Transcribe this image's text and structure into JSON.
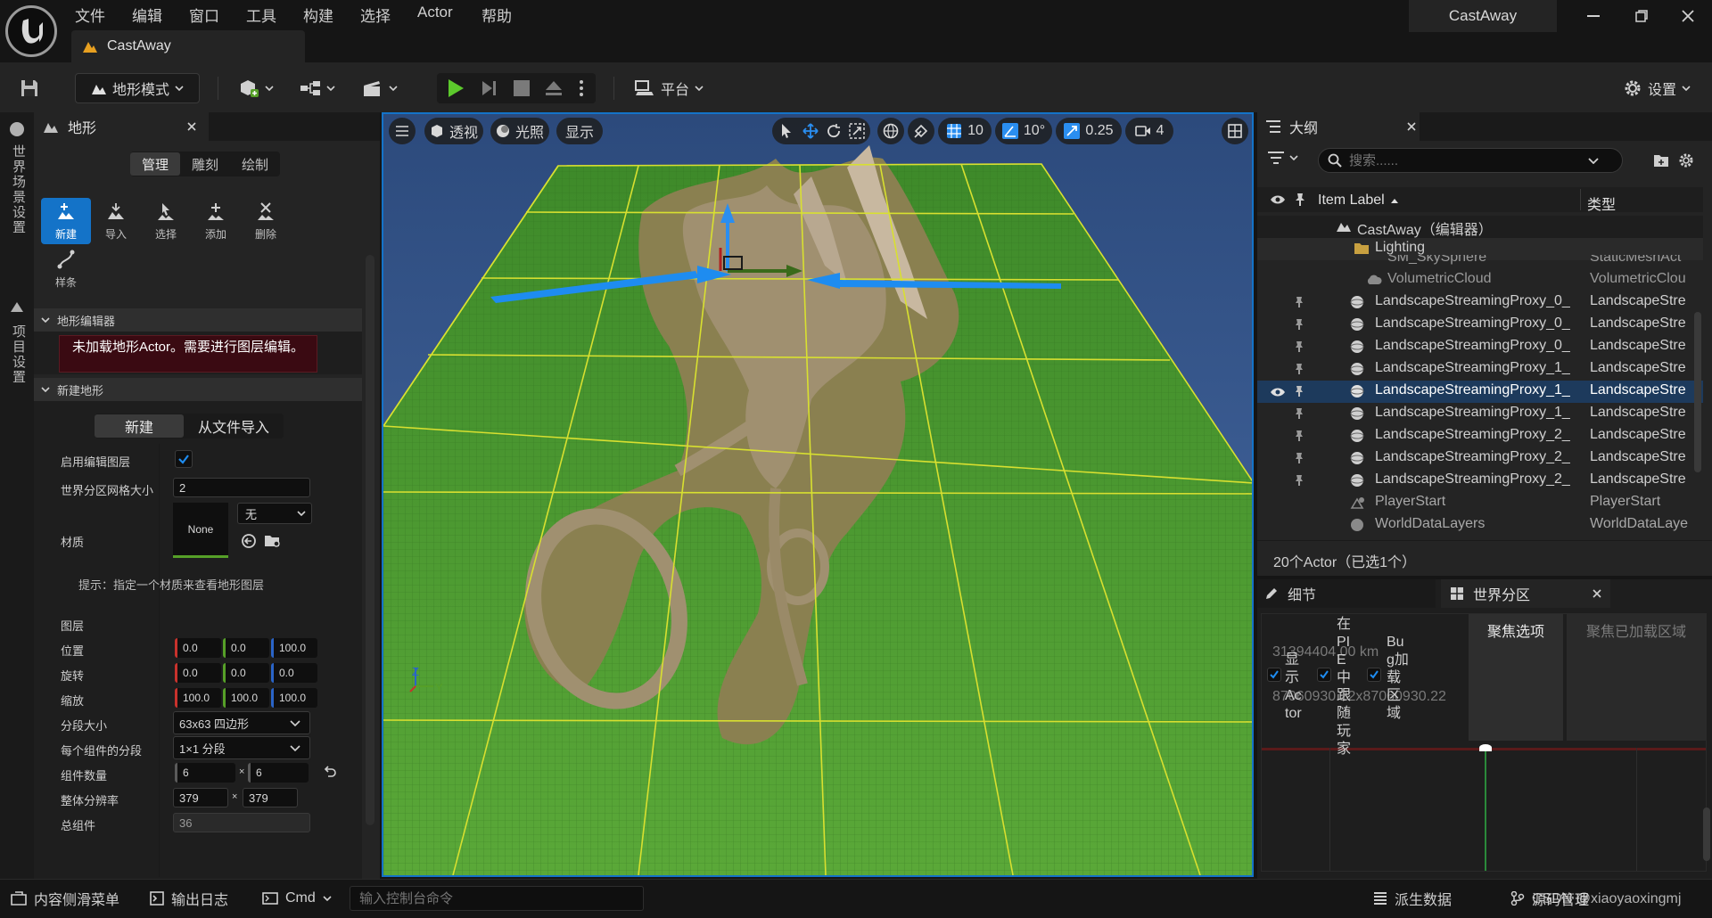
{
  "menu": {
    "items": [
      "文件",
      "编辑",
      "窗口",
      "工具",
      "构建",
      "选择",
      "Actor",
      "帮助"
    ]
  },
  "doc_tab": {
    "label": "CastAway"
  },
  "window": {
    "title": "CastAway"
  },
  "toolbar": {
    "mode_label": "地形模式",
    "platform_label": "平台",
    "settings_label": "设置"
  },
  "left_rail": {
    "world_settings": "世界场景设置",
    "project_settings": "项目设置"
  },
  "landscape": {
    "panel_title": "地形",
    "mode_tabs": [
      "管理",
      "雕刻",
      "绘制"
    ],
    "tools": {
      "new": "新建",
      "import": "导入",
      "select": "选择",
      "add": "添加",
      "delete": "删除",
      "spline": "样条"
    },
    "editor_section": "地形编辑器",
    "warning": "未加载地形Actor。需要进行图层编辑。",
    "new_section": "新建地形",
    "new_tabs": [
      "新建",
      "从文件导入"
    ],
    "enable_layers_label": "启用编辑图层",
    "grid_size_label": "世界分区网格大小",
    "grid_size_value": "2",
    "material_label": "材质",
    "material_thumb": "None",
    "material_select": "无",
    "hint": "提示：指定一个材质来查看地形图层",
    "layers_label": "图层",
    "location_label": "位置",
    "location": [
      "0.0",
      "0.0",
      "100.0"
    ],
    "rotation_label": "旋转",
    "rotation": [
      "0.0",
      "0.0",
      "0.0"
    ],
    "scale_label": "缩放",
    "scale": [
      "100.0",
      "100.0",
      "100.0"
    ],
    "section_size_label": "分段大小",
    "section_size_value": "63x63 四边形",
    "sections_per_comp_label": "每个组件的分段",
    "sections_per_comp_value": "1×1 分段",
    "comp_count_label": "组件数量",
    "comp_count": [
      "6",
      "6"
    ],
    "resolution_label": "整体分辨率",
    "resolution": [
      "379",
      "379"
    ],
    "total_comp_label": "总组件",
    "total_comp_value": "36",
    "times": "×"
  },
  "viewport": {
    "perspective": "透视",
    "lighting": "光照",
    "show": "显示",
    "grid_snap": "10",
    "rot_snap": "10°",
    "scale_snap": "0.25",
    "cam_speed": "4",
    "axis_z": "Z",
    "axis_y": "Y"
  },
  "outliner": {
    "title": "大纲",
    "search_placeholder": "搜索......",
    "col_label": "Item Label",
    "col_type": "类型",
    "rows": [
      {
        "label": "CastAway（编辑器）",
        "type": ""
      },
      {
        "label": "Lighting",
        "type": ""
      },
      {
        "label": "SM_SkySphere",
        "type": "StaticMeshAct"
      },
      {
        "label": "VolumetricCloud",
        "type": "VolumetricClou"
      },
      {
        "label": "LandscapeStreamingProxy_0_",
        "type": "LandscapeStre"
      },
      {
        "label": "LandscapeStreamingProxy_0_",
        "type": "LandscapeStre"
      },
      {
        "label": "LandscapeStreamingProxy_0_",
        "type": "LandscapeStre"
      },
      {
        "label": "LandscapeStreamingProxy_1_",
        "type": "LandscapeStre"
      },
      {
        "label": "LandscapeStreamingProxy_1_",
        "type": "LandscapeStre"
      },
      {
        "label": "LandscapeStreamingProxy_1_",
        "type": "LandscapeStre"
      },
      {
        "label": "LandscapeStreamingProxy_2_",
        "type": "LandscapeStre"
      },
      {
        "label": "LandscapeStreamingProxy_2_",
        "type": "LandscapeStre"
      },
      {
        "label": "LandscapeStreamingProxy_2_",
        "type": "LandscapeStre"
      },
      {
        "label": "PlayerStart",
        "type": "PlayerStart"
      },
      {
        "label": "WorldDataLayers",
        "type": "WorldDataLaye"
      }
    ],
    "footer": "20个Actor（已选1个）"
  },
  "details": {
    "tab_details": "细节",
    "tab_world_partition": "世界分区",
    "focus_selection": "聚焦选项",
    "focus_loaded": "聚焦已加载区域",
    "scale_text": "31394404.00 km",
    "size_text": "87060930.22x87060930.22",
    "opt_show_actor": "显示Actor",
    "opt_follow_player": "在PIE中跟随玩家",
    "opt_bug_region": "Bug加载区域"
  },
  "statusbar": {
    "content_drawer": "内容侧滑菜单",
    "output_log": "输出日志",
    "cmd": "Cmd",
    "console_placeholder": "输入控制台命令",
    "derived_data": "派生数据",
    "source_control": "源码管理",
    "watermark": "CSDN @xiaoyaoxingmj"
  },
  "colors": {
    "accent": "#1473c8",
    "selected_row": "#1d3a5c",
    "warning_bg": "#3a0a12",
    "vec_x": "#c8322c",
    "vec_y": "#56a028",
    "vec_z": "#2a64c8"
  }
}
